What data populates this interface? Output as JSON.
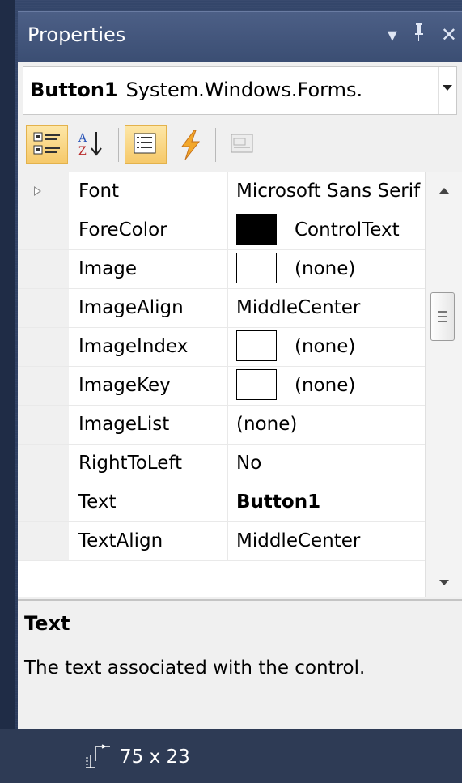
{
  "window": {
    "title": "Properties",
    "buttons": [
      "dropdown-icon",
      "pin-icon",
      "close-icon"
    ]
  },
  "object_selector": {
    "name": "Button1",
    "type": "System.Windows.Forms."
  },
  "toolbar": {
    "buttons": [
      {
        "name": "categorized-icon",
        "active": true
      },
      {
        "name": "alphabetical-icon",
        "active": false
      },
      {
        "name": "properties-icon",
        "active": true
      },
      {
        "name": "events-icon",
        "active": false
      },
      {
        "name": "property-pages-icon",
        "active": false,
        "disabled": true
      }
    ]
  },
  "properties": [
    {
      "name": "Font",
      "value": "Microsoft Sans Serif",
      "expandable": true
    },
    {
      "name": "ForeColor",
      "value": "ControlText",
      "swatch": "#000000"
    },
    {
      "name": "Image",
      "value": "(none)",
      "swatch": "#ffffff"
    },
    {
      "name": "ImageAlign",
      "value": "MiddleCenter"
    },
    {
      "name": "ImageIndex",
      "value": "(none)",
      "swatch": "#ffffff"
    },
    {
      "name": "ImageKey",
      "value": "(none)",
      "swatch": "#ffffff"
    },
    {
      "name": "ImageList",
      "value": "(none)"
    },
    {
      "name": "RightToLeft",
      "value": "No"
    },
    {
      "name": "Text",
      "value": "Button1",
      "bold": true
    },
    {
      "name": "TextAlign",
      "value": "MiddleCenter"
    }
  ],
  "description": {
    "title": "Text",
    "text": "The text associated with the control."
  },
  "status": {
    "size": "75 x 23"
  },
  "colors": {
    "title_bar": "#3e5178",
    "active_button": "#f8d57e",
    "panel": "#f0f0f0"
  }
}
